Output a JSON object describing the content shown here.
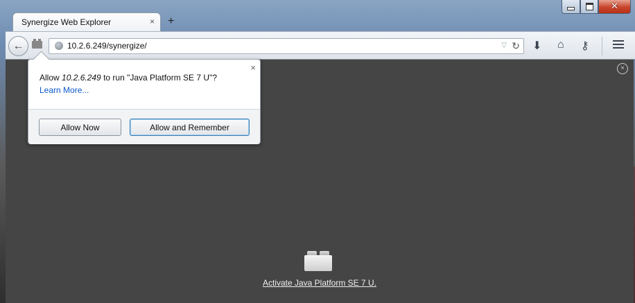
{
  "window": {
    "minimize_glyph": "",
    "close_glyph": "✕"
  },
  "tab": {
    "title": "Synergize Web Explorer",
    "close_glyph": "×",
    "new_tab_glyph": "+"
  },
  "toolbar": {
    "back_glyph": "←",
    "url": "10.2.6.249/synergize/",
    "dropmarker_glyph": "▽",
    "reload_glyph": "↻",
    "download_glyph": "⬇",
    "home_glyph": "⌂",
    "key_glyph": "⚷"
  },
  "popup": {
    "message_prefix": "Allow ",
    "message_host": "10.2.6.249",
    "message_suffix": " to run \"Java Platform SE 7 U\"?",
    "learn_more": "Learn More...",
    "close_glyph": "×",
    "allow_now": "Allow Now",
    "allow_remember": "Allow and Remember"
  },
  "content": {
    "close_glyph": "×",
    "activate_link": "Activate Java Platform SE 7 U."
  }
}
